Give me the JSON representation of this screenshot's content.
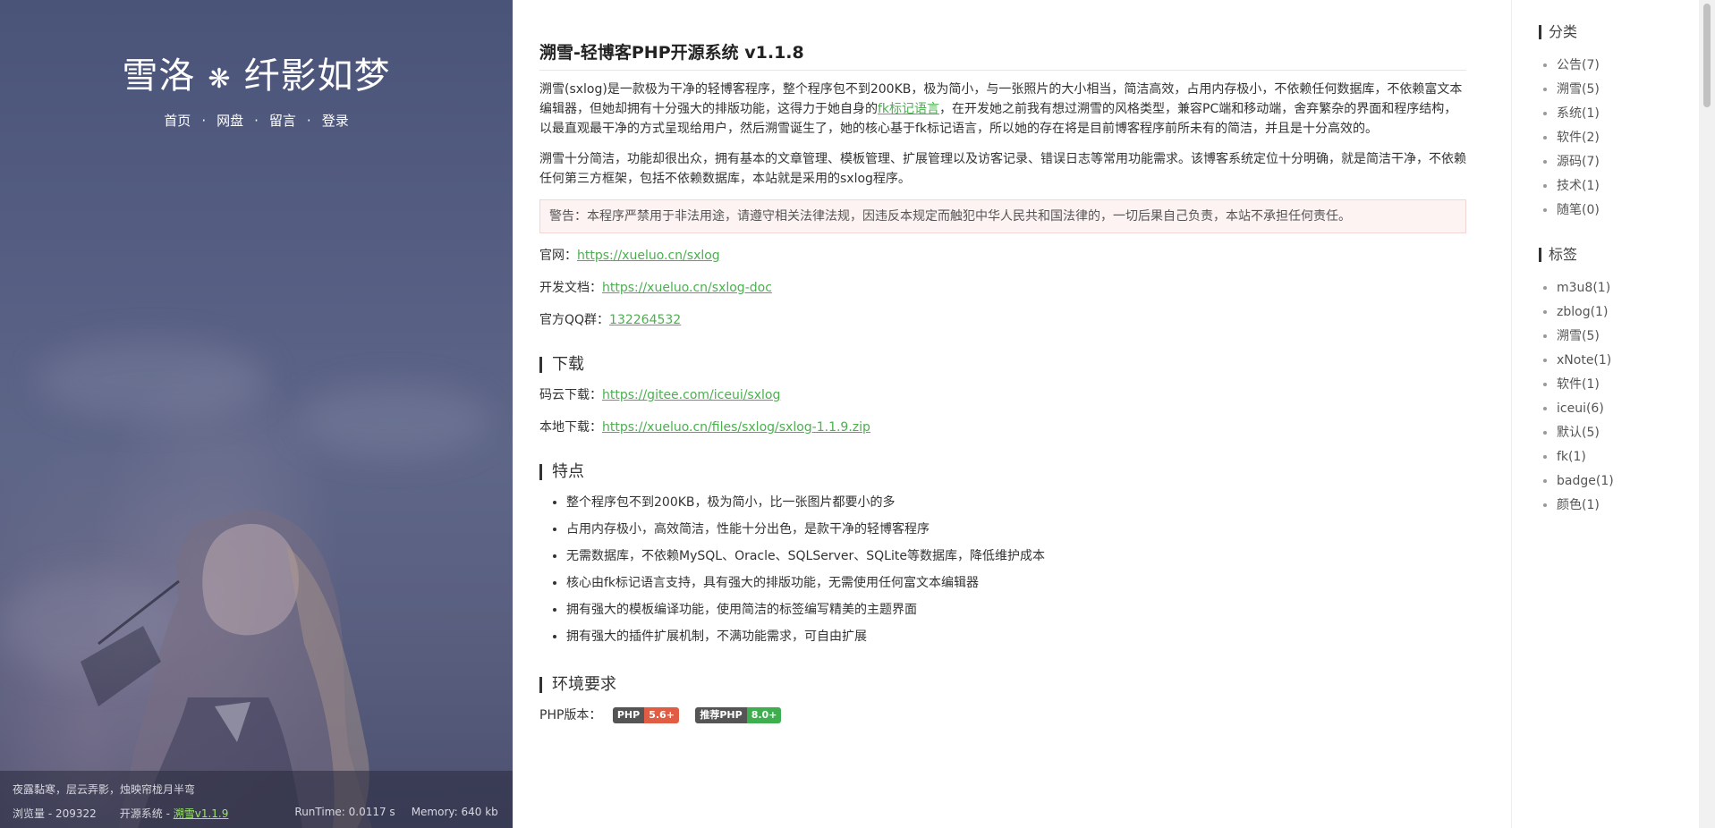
{
  "site": {
    "title_left": "雪洛",
    "title_sep": "❋",
    "title_right": "纤影如梦",
    "nav": [
      "首页",
      "网盘",
      "留言",
      "登录"
    ],
    "nav_sep": "·"
  },
  "left_footer": {
    "motto": "夜露黏寒，层云弄影，烛映帘栊月半弯",
    "views": "浏览量 - 209322",
    "system_label": "开源系统 - ",
    "system_link": "溯雪v1.1.9",
    "runtime": "RunTime: 0.0117 s",
    "memory": "Memory: 640 kb"
  },
  "post": {
    "title": "溯雪-轻博客PHP开源系统 v1.1.8",
    "para1_a": "溯雪(sxlog)是一款极为干净的轻博客程序，整个程序包不到200KB，极为简小，与一张照片的大小相当，简洁高效，占用内存极小，不依赖任何数据库，不依赖富文本编辑器，但她却拥有十分强大的排版功能，这得力于她自身的",
    "para1_link": "fk标记语言",
    "para1_b": "，在开发她之前我有想过溯雪的风格类型，兼容PC端和移动端，舍弃繁杂的界面和程序结构，以最直观最干净的方式呈现给用户，然后溯雪诞生了，她的核心基于fk标记语言，所以她的存在将是目前博客程序前所未有的简洁，并且是十分高效的。",
    "para2": "溯雪十分简洁，功能却很出众，拥有基本的文章管理、模板管理、扩展管理以及访客记录、错误日志等常用功能需求。该博客系统定位十分明确，就是简洁干净，不依赖任何第三方框架，包括不依赖数据库，本站就是采用的sxlog程序。",
    "warning": "警告：本程序严禁用于非法用途，请遵守相关法律法规，因违反本规定而触犯中华人民共和国法律的，一切后果自己负责，本站不承担任何责任。",
    "official_label": "官网：",
    "official_link": "https://xueluo.cn/sxlog",
    "doc_label": "开发文档：",
    "doc_link": "https://xueluo.cn/sxlog-doc",
    "qq_label": "官方QQ群：",
    "qq_link": "132264532",
    "download_heading": "下载",
    "gitee_label": "码云下载：",
    "gitee_link": "https://gitee.com/iceui/sxlog",
    "local_label": "本地下载：",
    "local_link": "https://xueluo.cn/files/sxlog/sxlog-1.1.9.zip",
    "features_heading": "特点",
    "features": [
      "整个程序包不到200KB，极为简小，比一张图片都要小的多",
      "占用内存极小，高效简洁，性能十分出色，是款干净的轻博客程序",
      "无需数据库，不依赖MySQL、Oracle、SQLServer、SQLite等数据库，降低维护成本",
      "核心由fk标记语言支持，具有强大的排版功能，无需使用任何富文本编辑器",
      "拥有强大的模板编译功能，使用简洁的标签编写精美的主题界面",
      "拥有强大的插件扩展机制，不满功能需求，可自由扩展"
    ],
    "env_heading": "环境要求",
    "php_label": "PHP版本：",
    "badge1_left": "PHP",
    "badge1_right": "5.6+",
    "badge2_left": "推荐PHP",
    "badge2_right": "8.0+"
  },
  "sidebar": {
    "categories_heading": "分类",
    "categories": [
      "公告(7)",
      "溯雪(5)",
      "系统(1)",
      "软件(2)",
      "源码(7)",
      "技术(1)",
      "随笔(0)"
    ],
    "tags_heading": "标签",
    "tags": [
      "m3u8(1)",
      "zblog(1)",
      "溯雪(5)",
      "xNote(1)",
      "软件(1)",
      "iceui(6)",
      "默认(5)",
      "fk(1)",
      "badge(1)",
      "颜色(1)"
    ]
  }
}
